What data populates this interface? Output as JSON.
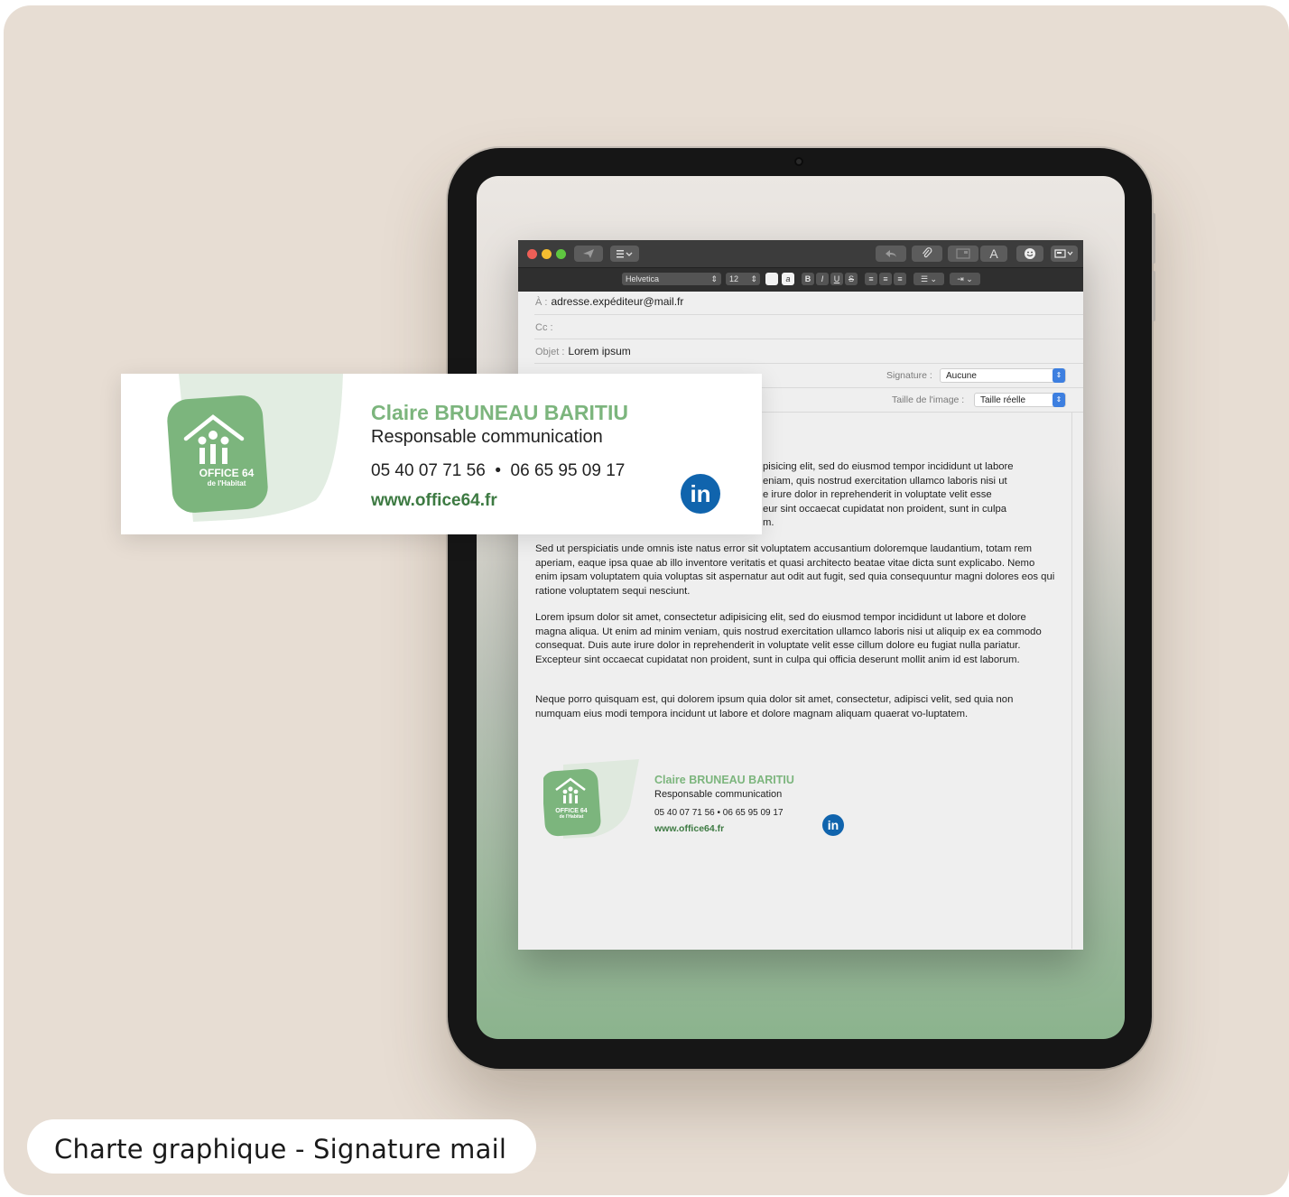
{
  "caption": "Charte graphique - Signature mail",
  "toolbar": {
    "font_name": "Helvetica",
    "font_size": "12",
    "bold": "B",
    "italic": "I",
    "underline": "U",
    "strike": "S",
    "text_button": "A"
  },
  "mail": {
    "to_label": "À :",
    "to_value": "adresse.expéditeur@mail.fr",
    "cc_label": "Cc :",
    "subject_label": "Objet :",
    "subject_value": "Lorem ipsum",
    "signature_label": "Signature :",
    "signature_value": "Aucune",
    "image_size_label": "Taille de l'image :",
    "image_size_value": "Taille réelle",
    "paragraph1_lines": [
      "pisicing elit, sed do eiusmod tempor incididunt ut labore",
      "eniam, quis nostrud exercitation ullamco laboris nisi ut",
      "e irure dolor in reprehenderit in voluptate velit esse",
      "eur sint occaecat cupidatat non proident, sunt in culpa",
      "m."
    ],
    "paragraph2": "Sed ut perspiciatis unde omnis iste natus error sit voluptatem accusantium doloremque laudantium, totam rem aperiam, eaque ipsa quae ab illo inventore veritatis et quasi architecto beatae vitae dicta sunt explicabo. Nemo enim ipsam voluptatem quia voluptas sit aspernatur aut odit aut fugit, sed quia consequuntur magni dolores eos qui ratione voluptatem sequi nesciunt.",
    "paragraph3": "Lorem ipsum dolor sit amet, consectetur adipisicing elit, sed do eiusmod tempor incididunt ut labore et dolore magna aliqua. Ut enim ad minim veniam, quis nostrud exercitation ullamco laboris nisi ut aliquip ex ea commodo consequat. Duis aute irure dolor in reprehenderit in voluptate velit esse cillum dolore eu fugiat nulla pariatur. Excepteur sint occaecat cupidatat non proident, sunt in culpa qui officia deserunt mollit anim id est laborum.",
    "paragraph4": "Neque porro quisquam est, qui dolorem ipsum quia dolor sit amet, consectetur, adipisci velit, sed quia non numquam eius modi tempora incidunt ut labore et dolore magnam aliquam quaerat vo-luptatem."
  },
  "signature": {
    "name": "Claire BRUNEAU BARITIU",
    "role": "Responsable communication",
    "phone": "05 40 07 71 56  •  06 65 95 09 17",
    "phone_small": "05 40 07 71 56  •  06 65 95 09 17",
    "website": "www.office64.fr",
    "logo_line1": "OFFICE 64",
    "logo_line2": "de l'Habitat",
    "linkedin": "in"
  },
  "colors": {
    "brand_green": "#7cb57d",
    "brand_dark_green": "#3d7a42",
    "linkedin_blue": "#1064ad",
    "background": "#e7ddd3"
  },
  "icons": [
    "send-icon",
    "list-icon",
    "reply-icon",
    "paperclip-icon",
    "photo-browser-icon",
    "font-icon",
    "emoji-icon",
    "image-icon",
    "linkedin-icon",
    "office64-logo"
  ]
}
